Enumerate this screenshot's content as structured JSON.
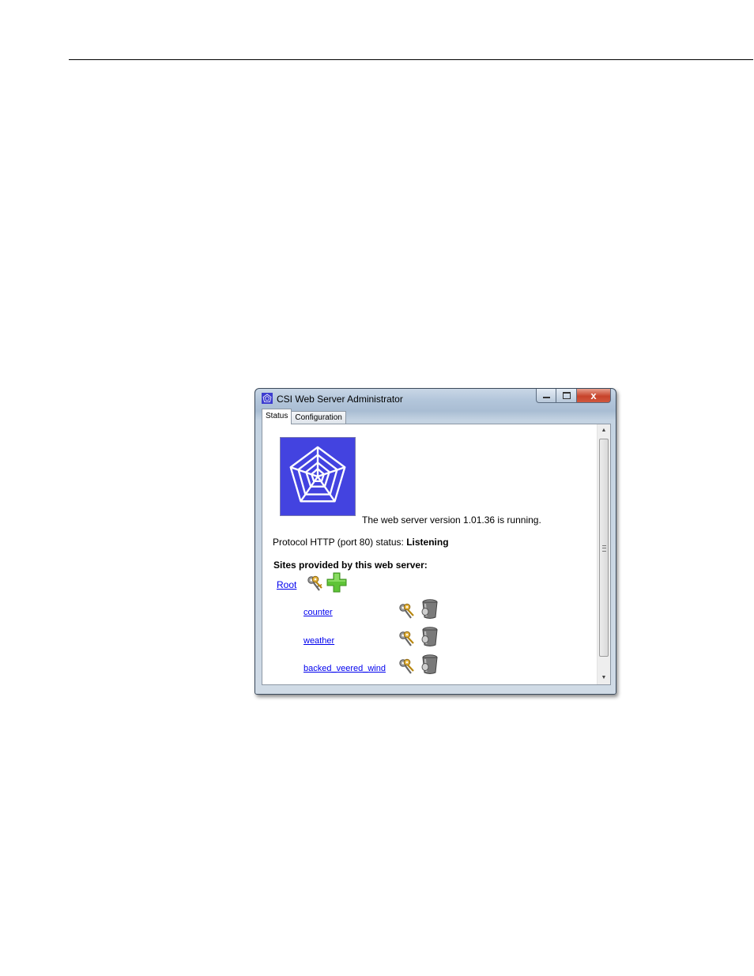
{
  "window": {
    "title": "CSI Web Server Administrator",
    "controls": {
      "minimize": "minimize-icon",
      "maximize": "maximize-icon",
      "close": "close-icon"
    },
    "close_glyph": "x"
  },
  "tabs": [
    {
      "label": "Status",
      "active": true
    },
    {
      "label": "Configuration",
      "active": false
    }
  ],
  "status": {
    "running_text": "The web server version 1.01.36 is running.",
    "protocol_label": "Protocol HTTP (port 80) status:",
    "protocol_state": "Listening",
    "sites_heading": "Sites provided by this web server:"
  },
  "sites": {
    "root": {
      "label": "Root",
      "icons": [
        "keys-icon",
        "add-plus-icon"
      ]
    },
    "children": [
      {
        "label": "counter",
        "icons": [
          "keys-icon",
          "trash-can-icon"
        ]
      },
      {
        "label": "weather",
        "icons": [
          "keys-icon",
          "trash-can-icon"
        ]
      },
      {
        "label": "backed_veered_wind",
        "icons": [
          "keys-icon",
          "trash-can-icon"
        ]
      }
    ]
  },
  "colors": {
    "link": "#0000ee",
    "logo_bg": "#4343e0",
    "add_icon": "#5ec437"
  }
}
